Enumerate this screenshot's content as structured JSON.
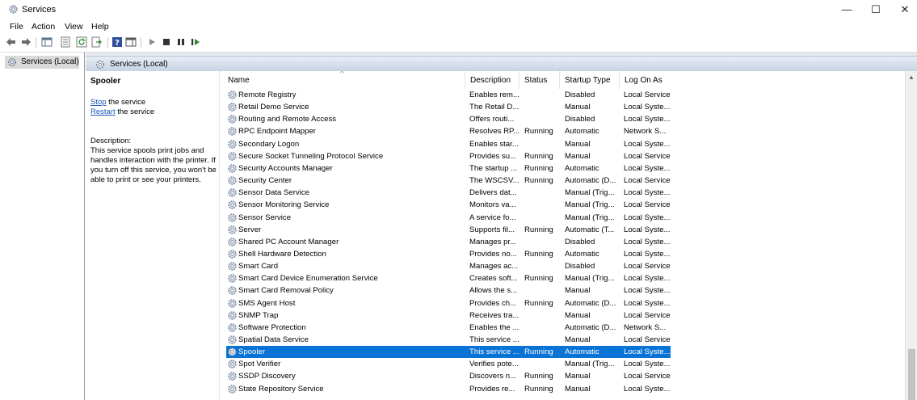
{
  "window": {
    "title": "Services",
    "minimize": "—",
    "maximize": "☐",
    "close": "✕"
  },
  "menu": [
    "File",
    "Action",
    "View",
    "Help"
  ],
  "tree": {
    "root_label": "Services (Local)"
  },
  "content_header": "Services (Local)",
  "details": {
    "title": "Spooler",
    "stop_link": "Stop",
    "stop_suffix": " the service",
    "restart_link": "Restart",
    "restart_suffix": " the service",
    "description_label": "Description:",
    "description": "This service spools print jobs and handles interaction with the printer. If you turn off this service, you won't be able to print or see your printers."
  },
  "columns": {
    "name": "Name",
    "description": "Description",
    "status": "Status",
    "startup": "Startup Type",
    "logon": "Log On As"
  },
  "selected_service": "Spooler",
  "colors": {
    "selection": "#0a73d6",
    "link": "#1a55b8",
    "header_band": "#c5d2e3"
  },
  "services": [
    {
      "name": "Remote Registry",
      "description": "Enables rem...",
      "status": "",
      "startup": "Disabled",
      "logon": "Local Service"
    },
    {
      "name": "Retail Demo Service",
      "description": "The Retail D...",
      "status": "",
      "startup": "Manual",
      "logon": "Local Syste..."
    },
    {
      "name": "Routing and Remote Access",
      "description": "Offers routi...",
      "status": "",
      "startup": "Disabled",
      "logon": "Local Syste..."
    },
    {
      "name": "RPC Endpoint Mapper",
      "description": "Resolves RP...",
      "status": "Running",
      "startup": "Automatic",
      "logon": "Network S..."
    },
    {
      "name": "Secondary Logon",
      "description": "Enables star...",
      "status": "",
      "startup": "Manual",
      "logon": "Local Syste..."
    },
    {
      "name": "Secure Socket Tunneling Protocol Service",
      "description": "Provides su...",
      "status": "Running",
      "startup": "Manual",
      "logon": "Local Service"
    },
    {
      "name": "Security Accounts Manager",
      "description": "The startup ...",
      "status": "Running",
      "startup": "Automatic",
      "logon": "Local Syste..."
    },
    {
      "name": "Security Center",
      "description": "The WSCSV...",
      "status": "Running",
      "startup": "Automatic (D...",
      "logon": "Local Service"
    },
    {
      "name": "Sensor Data Service",
      "description": "Delivers dat...",
      "status": "",
      "startup": "Manual (Trig...",
      "logon": "Local Syste..."
    },
    {
      "name": "Sensor Monitoring Service",
      "description": "Monitors va...",
      "status": "",
      "startup": "Manual (Trig...",
      "logon": "Local Service"
    },
    {
      "name": "Sensor Service",
      "description": "A service fo...",
      "status": "",
      "startup": "Manual (Trig...",
      "logon": "Local Syste..."
    },
    {
      "name": "Server",
      "description": "Supports fil...",
      "status": "Running",
      "startup": "Automatic (T...",
      "logon": "Local Syste..."
    },
    {
      "name": "Shared PC Account Manager",
      "description": "Manages pr...",
      "status": "",
      "startup": "Disabled",
      "logon": "Local Syste..."
    },
    {
      "name": "Shell Hardware Detection",
      "description": "Provides no...",
      "status": "Running",
      "startup": "Automatic",
      "logon": "Local Syste..."
    },
    {
      "name": "Smart Card",
      "description": "Manages ac...",
      "status": "",
      "startup": "Disabled",
      "logon": "Local Service"
    },
    {
      "name": "Smart Card Device Enumeration Service",
      "description": "Creates soft...",
      "status": "Running",
      "startup": "Manual (Trig...",
      "logon": "Local Syste..."
    },
    {
      "name": "Smart Card Removal Policy",
      "description": "Allows the s...",
      "status": "",
      "startup": "Manual",
      "logon": "Local Syste..."
    },
    {
      "name": "SMS Agent Host",
      "description": "Provides ch...",
      "status": "Running",
      "startup": "Automatic (D...",
      "logon": "Local Syste..."
    },
    {
      "name": "SNMP Trap",
      "description": "Receives tra...",
      "status": "",
      "startup": "Manual",
      "logon": "Local Service"
    },
    {
      "name": "Software Protection",
      "description": "Enables the ...",
      "status": "",
      "startup": "Automatic (D...",
      "logon": "Network S..."
    },
    {
      "name": "Spatial Data Service",
      "description": "This service ...",
      "status": "",
      "startup": "Manual",
      "logon": "Local Service"
    },
    {
      "name": "Spooler",
      "description": "This service ...",
      "status": "Running",
      "startup": "Automatic",
      "logon": "Local Syste..."
    },
    {
      "name": "Spot Verifier",
      "description": "Verifies pote...",
      "status": "",
      "startup": "Manual (Trig...",
      "logon": "Local Syste..."
    },
    {
      "name": "SSDP Discovery",
      "description": "Discovers n...",
      "status": "Running",
      "startup": "Manual",
      "logon": "Local Service"
    },
    {
      "name": "State Repository Service",
      "description": "Provides re...",
      "status": "Running",
      "startup": "Manual",
      "logon": "Local Syste..."
    }
  ]
}
